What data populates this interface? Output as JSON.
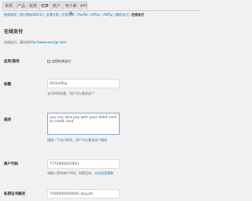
{
  "tabs": [
    {
      "label": "常规"
    },
    {
      "label": "产品"
    },
    {
      "label": "税费"
    },
    {
      "label": "结算"
    },
    {
      "label": "账户"
    },
    {
      "label": "电子邮件"
    },
    {
      "label": "API"
    }
  ],
  "subnav": {
    "items": [
      "结账选项",
      "银行转账(BACS)",
      "支票付款",
      "货到付款",
      "PayPal",
      "AliPay",
      "AliPay",
      "微信支付",
      "在线支付"
    ],
    "current": "在线支付"
  },
  "section": {
    "title": "在线支付",
    "desc_prefix": "在线支付，请访问",
    "desc_link": "http://www.wenrgs.com"
  },
  "fields": {
    "enable": {
      "label": "启用/禁用",
      "checkbox_label": "启用在线支付",
      "checked": false
    },
    "title": {
      "label": "标题",
      "value": "OnlinePay",
      "help": "支付时的标题，用户可以看到这个"
    },
    "description": {
      "label": "描述",
      "value": "you can also pay with your debit card or credit card",
      "help": "描述一下支付网关，用户可以看到这个描述"
    },
    "merchant_id": {
      "label": "商户代码",
      "value": "7772905661803",
      "help_prefix": "请输入您的商户代码，如果没有，",
      "help_link": "点击这里获取"
    },
    "private_key": {
      "label": "私钥证书路径",
      "value": "7000000000000_key.pfx"
    }
  },
  "colors": {
    "link": "#0073aa",
    "focus_border": "#7ea6d3"
  }
}
